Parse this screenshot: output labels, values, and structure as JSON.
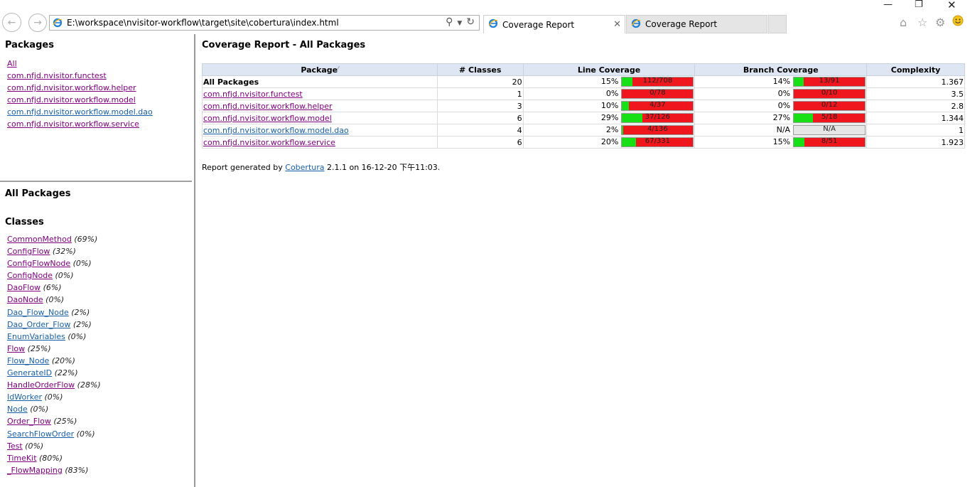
{
  "browser": {
    "url": "E:\\workspace\\nvisitor-workflow\\target\\site\\cobertura\\index.html",
    "tabs": [
      {
        "label": "Coverage Report",
        "active": true
      },
      {
        "label": "Coverage Report",
        "active": false
      }
    ]
  },
  "packages_frame": {
    "title": "Packages",
    "items": [
      "All",
      "com.nfjd.nvisitor.functest",
      "com.nfjd.nvisitor.workflow.helper",
      "com.nfjd.nvisitor.workflow.model",
      "com.nfjd.nvisitor.workflow.model.dao",
      "com.nfjd.nvisitor.workflow.service"
    ]
  },
  "classes_frame": {
    "title": "All Packages",
    "subtitle": "Classes",
    "items": [
      {
        "name": "CommonMethod",
        "pct": "(69%)",
        "visited": true
      },
      {
        "name": "ConfigFlow",
        "pct": "(32%)",
        "visited": true
      },
      {
        "name": "ConfigFlowNode",
        "pct": "(0%)",
        "visited": true
      },
      {
        "name": "ConfigNode",
        "pct": "(0%)",
        "visited": true
      },
      {
        "name": "DaoFlow",
        "pct": "(6%)",
        "visited": true
      },
      {
        "name": "DaoNode",
        "pct": "(0%)",
        "visited": true
      },
      {
        "name": "Dao_Flow_Node",
        "pct": "(2%)",
        "visited": false
      },
      {
        "name": "Dao_Order_Flow",
        "pct": "(2%)",
        "visited": false
      },
      {
        "name": "EnumVariables",
        "pct": "(0%)",
        "visited": false
      },
      {
        "name": "Flow",
        "pct": "(25%)",
        "visited": true
      },
      {
        "name": "Flow_Node",
        "pct": "(20%)",
        "visited": false
      },
      {
        "name": "GenerateID",
        "pct": "(22%)",
        "visited": false
      },
      {
        "name": "HandleOrderFlow",
        "pct": "(28%)",
        "visited": true
      },
      {
        "name": "IdWorker",
        "pct": "(0%)",
        "visited": false
      },
      {
        "name": "Node",
        "pct": "(0%)",
        "visited": false
      },
      {
        "name": "Order_Flow",
        "pct": "(25%)",
        "visited": true
      },
      {
        "name": "SearchFlowOrder",
        "pct": "(0%)",
        "visited": false
      },
      {
        "name": "Test",
        "pct": "(0%)",
        "visited": true
      },
      {
        "name": "TimeKit",
        "pct": "(80%)",
        "visited": true
      },
      {
        "name": "_FlowMapping",
        "pct": "(83%)",
        "visited": true
      }
    ]
  },
  "report": {
    "title": "Coverage Report - All Packages",
    "headers": [
      "Package",
      "# Classes",
      "Line Coverage",
      "Branch Coverage",
      "Complexity"
    ],
    "rows": [
      {
        "name": "All Packages",
        "link": false,
        "classes": "20",
        "line_pct": "15%",
        "line_frac": 0.15,
        "line_label": "112/708",
        "branch_pct": "14%",
        "branch_frac": 0.14,
        "branch_label": "13/91",
        "complexity": "1.367"
      },
      {
        "name": "com.nfjd.nvisitor.functest",
        "link": true,
        "visited": true,
        "classes": "1",
        "line_pct": "0%",
        "line_frac": 0,
        "line_label": "0/78",
        "branch_pct": "0%",
        "branch_frac": 0,
        "branch_label": "0/10",
        "complexity": "3.5"
      },
      {
        "name": "com.nfjd.nvisitor.workflow.helper",
        "link": true,
        "visited": true,
        "classes": "3",
        "line_pct": "10%",
        "line_frac": 0.1,
        "line_label": "4/37",
        "branch_pct": "0%",
        "branch_frac": 0,
        "branch_label": "0/12",
        "complexity": "2.8"
      },
      {
        "name": "com.nfjd.nvisitor.workflow.model",
        "link": true,
        "visited": true,
        "classes": "6",
        "line_pct": "29%",
        "line_frac": 0.29,
        "line_label": "37/126",
        "branch_pct": "27%",
        "branch_frac": 0.27,
        "branch_label": "5/18",
        "complexity": "1.344"
      },
      {
        "name": "com.nfjd.nvisitor.workflow.model.dao",
        "link": true,
        "visited": false,
        "classes": "4",
        "line_pct": "2%",
        "line_frac": 0.02,
        "line_label": "4/136",
        "branch_pct": "N/A",
        "branch_frac": null,
        "branch_label": "N/A",
        "complexity": "1"
      },
      {
        "name": "com.nfjd.nvisitor.workflow.service",
        "link": true,
        "visited": true,
        "classes": "6",
        "line_pct": "20%",
        "line_frac": 0.2,
        "line_label": "67/331",
        "branch_pct": "15%",
        "branch_frac": 0.15,
        "branch_label": "8/51",
        "complexity": "1.923"
      }
    ],
    "footer_prefix": "Report generated by ",
    "footer_link": "Cobertura",
    "footer_suffix": " 2.1.1 on 16-12-20 下午11:03."
  },
  "colors": {
    "covered": "#17e017",
    "uncovered": "#f0161d",
    "header_bg": "#dde6f2",
    "visited_link": "#800080",
    "link": "#1760a8"
  }
}
